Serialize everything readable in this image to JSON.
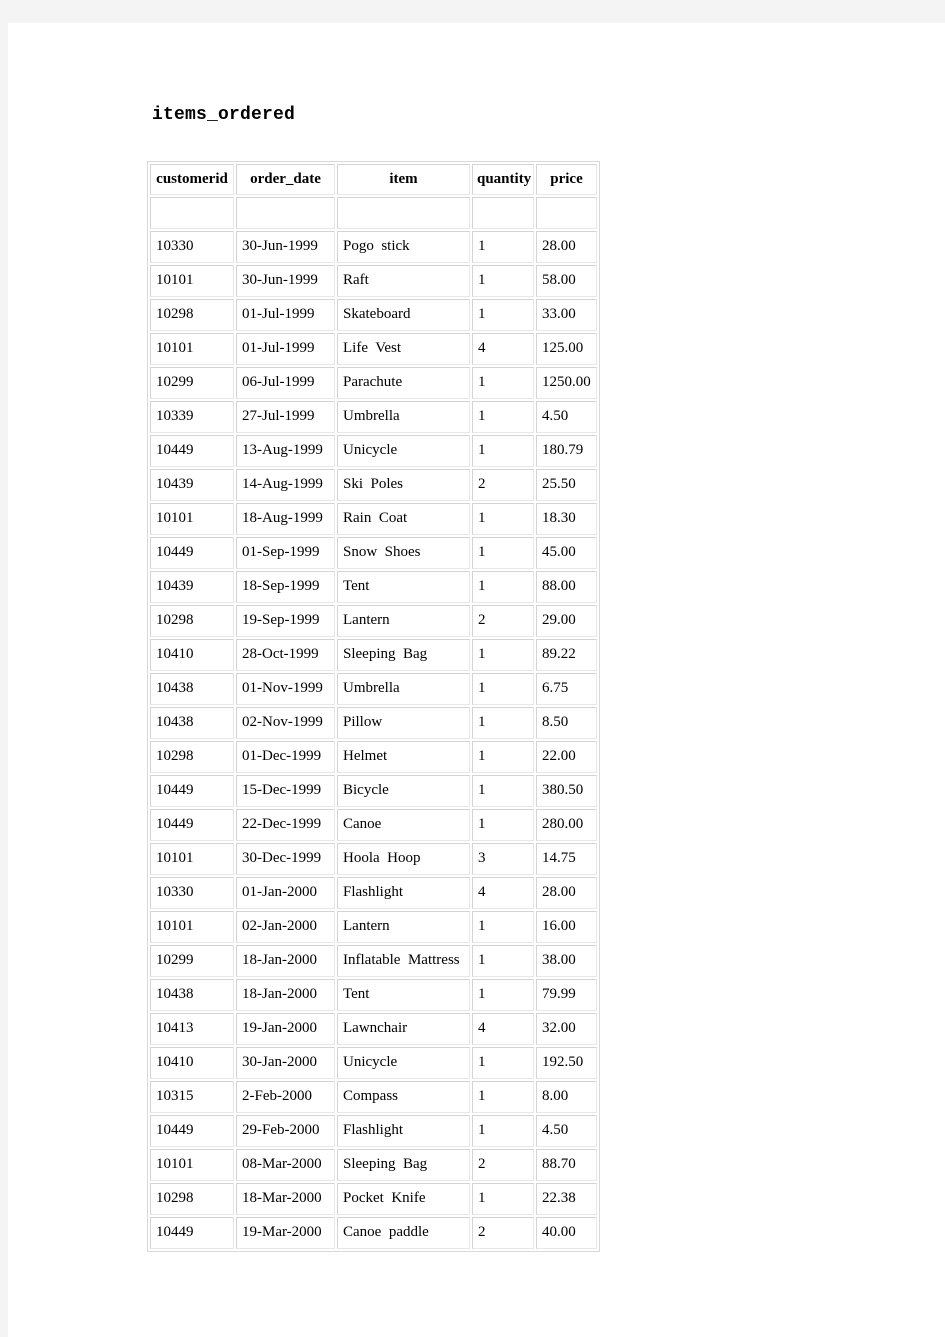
{
  "page": {
    "title": "items_ordered",
    "background_color": "#f4f4f4",
    "sheet_color": "#ffffff",
    "text_color": "#000000",
    "table_border_color": "#d9d9d9"
  },
  "table": {
    "name": "items_ordered",
    "columns": [
      {
        "key": "customerid",
        "label": "customerid"
      },
      {
        "key": "order_date",
        "label": "order_date"
      },
      {
        "key": "item",
        "label": "item"
      },
      {
        "key": "quantity",
        "label": "quantity"
      },
      {
        "key": "price",
        "label": "price"
      }
    ],
    "blank_row": {
      "customerid": "",
      "order_date": "",
      "item": "",
      "quantity": "",
      "price": ""
    },
    "rows": [
      {
        "customerid": "10330",
        "order_date": "30-Jun-1999",
        "item": "Pogo  stick",
        "quantity": "1",
        "price": "28.00"
      },
      {
        "customerid": "10101",
        "order_date": "30-Jun-1999",
        "item": "Raft",
        "quantity": "1",
        "price": "58.00"
      },
      {
        "customerid": "10298",
        "order_date": "01-Jul-1999",
        "item": "Skateboard",
        "quantity": "1",
        "price": "33.00"
      },
      {
        "customerid": "10101",
        "order_date": "01-Jul-1999",
        "item": "Life  Vest",
        "quantity": "4",
        "price": "125.00"
      },
      {
        "customerid": "10299",
        "order_date": "06-Jul-1999",
        "item": "Parachute",
        "quantity": "1",
        "price": "1250.00"
      },
      {
        "customerid": "10339",
        "order_date": "27-Jul-1999",
        "item": "Umbrella",
        "quantity": "1",
        "price": "4.50"
      },
      {
        "customerid": "10449",
        "order_date": "13-Aug-1999",
        "item": "Unicycle",
        "quantity": "1",
        "price": "180.79"
      },
      {
        "customerid": "10439",
        "order_date": "14-Aug-1999",
        "item": "Ski  Poles",
        "quantity": "2",
        "price": "25.50"
      },
      {
        "customerid": "10101",
        "order_date": "18-Aug-1999",
        "item": "Rain  Coat",
        "quantity": "1",
        "price": "18.30"
      },
      {
        "customerid": "10449",
        "order_date": "01-Sep-1999",
        "item": "Snow  Shoes",
        "quantity": "1",
        "price": "45.00"
      },
      {
        "customerid": "10439",
        "order_date": "18-Sep-1999",
        "item": "Tent",
        "quantity": "1",
        "price": "88.00"
      },
      {
        "customerid": "10298",
        "order_date": "19-Sep-1999",
        "item": "Lantern",
        "quantity": "2",
        "price": "29.00"
      },
      {
        "customerid": "10410",
        "order_date": "28-Oct-1999",
        "item": "Sleeping  Bag",
        "quantity": "1",
        "price": "89.22"
      },
      {
        "customerid": "10438",
        "order_date": "01-Nov-1999",
        "item": "Umbrella",
        "quantity": "1",
        "price": "6.75"
      },
      {
        "customerid": "10438",
        "order_date": "02-Nov-1999",
        "item": "Pillow",
        "quantity": "1",
        "price": "8.50"
      },
      {
        "customerid": "10298",
        "order_date": "01-Dec-1999",
        "item": "Helmet",
        "quantity": "1",
        "price": "22.00"
      },
      {
        "customerid": "10449",
        "order_date": "15-Dec-1999",
        "item": "Bicycle",
        "quantity": "1",
        "price": "380.50"
      },
      {
        "customerid": "10449",
        "order_date": "22-Dec-1999",
        "item": "Canoe",
        "quantity": "1",
        "price": "280.00"
      },
      {
        "customerid": "10101",
        "order_date": "30-Dec-1999",
        "item": "Hoola  Hoop",
        "quantity": "3",
        "price": "14.75"
      },
      {
        "customerid": "10330",
        "order_date": "01-Jan-2000",
        "item": "Flashlight",
        "quantity": "4",
        "price": "28.00"
      },
      {
        "customerid": "10101",
        "order_date": "02-Jan-2000",
        "item": "Lantern",
        "quantity": "1",
        "price": "16.00"
      },
      {
        "customerid": "10299",
        "order_date": "18-Jan-2000",
        "item": "Inflatable  Mattress",
        "quantity": "1",
        "price": "38.00"
      },
      {
        "customerid": "10438",
        "order_date": "18-Jan-2000",
        "item": "Tent",
        "quantity": "1",
        "price": "79.99"
      },
      {
        "customerid": "10413",
        "order_date": "19-Jan-2000",
        "item": "Lawnchair",
        "quantity": "4",
        "price": "32.00"
      },
      {
        "customerid": "10410",
        "order_date": "30-Jan-2000",
        "item": "Unicycle",
        "quantity": "1",
        "price": "192.50"
      },
      {
        "customerid": "10315",
        "order_date": "2-Feb-2000",
        "item": "Compass",
        "quantity": "1",
        "price": "8.00"
      },
      {
        "customerid": "10449",
        "order_date": "29-Feb-2000",
        "item": "Flashlight",
        "quantity": "1",
        "price": "4.50"
      },
      {
        "customerid": "10101",
        "order_date": "08-Mar-2000",
        "item": "Sleeping  Bag",
        "quantity": "2",
        "price": "88.70"
      },
      {
        "customerid": "10298",
        "order_date": "18-Mar-2000",
        "item": "Pocket  Knife",
        "quantity": "1",
        "price": "22.38"
      },
      {
        "customerid": "10449",
        "order_date": "19-Mar-2000",
        "item": "Canoe  paddle",
        "quantity": "2",
        "price": "40.00"
      }
    ]
  }
}
